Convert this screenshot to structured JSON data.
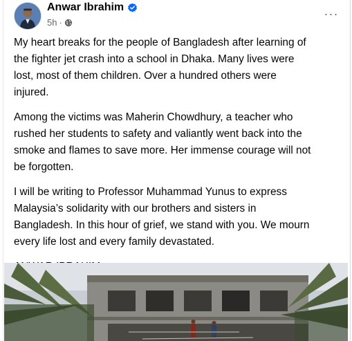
{
  "post": {
    "author": "Anwar Ibrahim",
    "verified_icon": "verified-badge-icon",
    "time": "5h",
    "separator": "·",
    "audience_icon": "globe-icon",
    "more_icon": "more-options-icon",
    "more_label": "···",
    "paragraphs": [
      "My heart breaks for the people of Bangladesh after learning of\nthe fighter jet crash into a school in Dhaka. Many lives were\nlost, most of them children. Over a hundred others were\ninjured.",
      "Among the victims was Maherin Chowdhury, a teacher who\nrushed her students to safety and valiantly went back into the\nsmoke and flames to save more. Her immense courage will not\nbe forgotten.",
      "I will be writing to Professor Muhammad Yunus to express\nMalaysia’s solidarity with our brothers and sisters in\nBangladesh. In this hour of grief, we stand with you. We mourn\nevery life lost and every family devastated.",
      "ANWAR IBRAHIM"
    ]
  },
  "colors": {
    "verified_blue": "#0866ff",
    "secondary_text": "#65676b"
  }
}
